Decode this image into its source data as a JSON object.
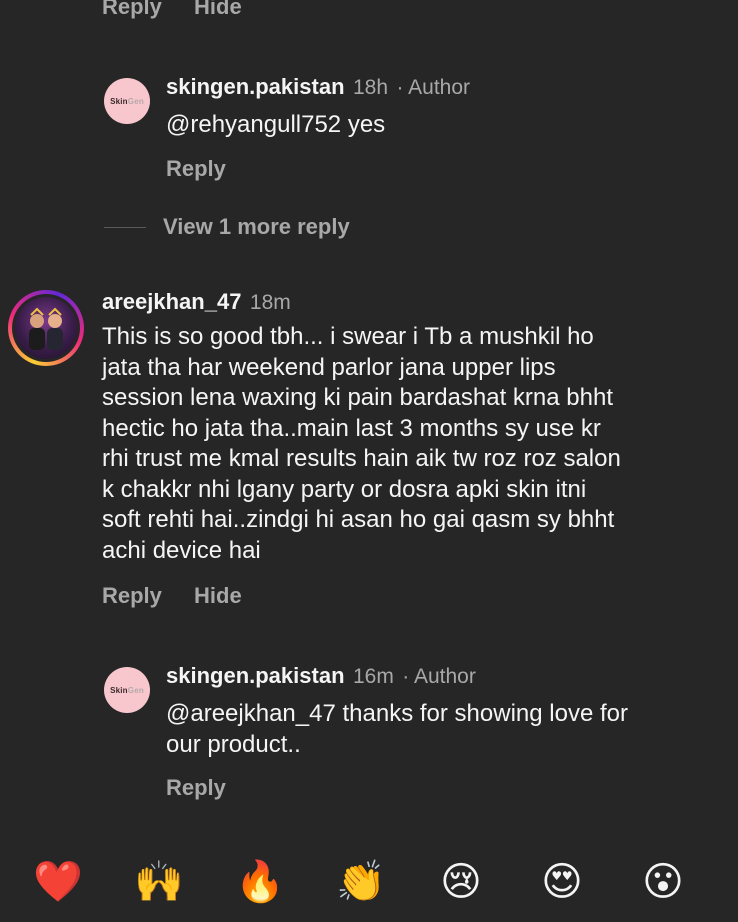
{
  "top_actions": {
    "reply": "Reply",
    "hide": "Hide"
  },
  "comments": [
    {
      "id": "reply-1",
      "avatar_text": "Skin",
      "avatar_text_2": "Gen",
      "username": "skingen.pakistan",
      "time": "18h",
      "badge": "· Author",
      "text": "@rehyangull752 yes",
      "reply_label": "Reply"
    },
    {
      "id": "comment-2",
      "username": "areejkhan_47",
      "time": "18m",
      "text_lines": [
        "This is so good tbh... i swear i Tb a mushkil ho",
        "jata tha har weekend parlor jana upper lips",
        "session lena waxing ki pain bardashat krna bhht",
        "hectic ho jata tha..main last 3 months sy use kr",
        "rhi trust me kmal results hain aik tw roz roz salon",
        "k chakkr nhi lgany party or dosra apki skin itni",
        "soft rehti hai..zindgi hi asan ho gai qasm sy bhht",
        "achi device hai"
      ],
      "reply_label": "Reply",
      "hide_label": "Hide"
    },
    {
      "id": "reply-2",
      "avatar_text": "Skin",
      "avatar_text_2": "Gen",
      "username": "skingen.pakistan",
      "time": "16m",
      "badge": "· Author",
      "text_lines": [
        "@areejkhan_47 thanks for showing love for",
        "our product.."
      ],
      "reply_label": "Reply"
    }
  ],
  "view_more": "View 1 more reply",
  "reactions": [
    {
      "name": "red-heart",
      "glyph": "❤️"
    },
    {
      "name": "raising-hands",
      "glyph": "🙌"
    },
    {
      "name": "fire",
      "glyph": "🔥"
    },
    {
      "name": "clapping-hands",
      "glyph": "👏"
    },
    {
      "name": "crying-face",
      "glyph": "😢"
    },
    {
      "name": "heart-eyes",
      "glyph": "😍"
    },
    {
      "name": "surprised-face",
      "glyph": "😮"
    }
  ]
}
